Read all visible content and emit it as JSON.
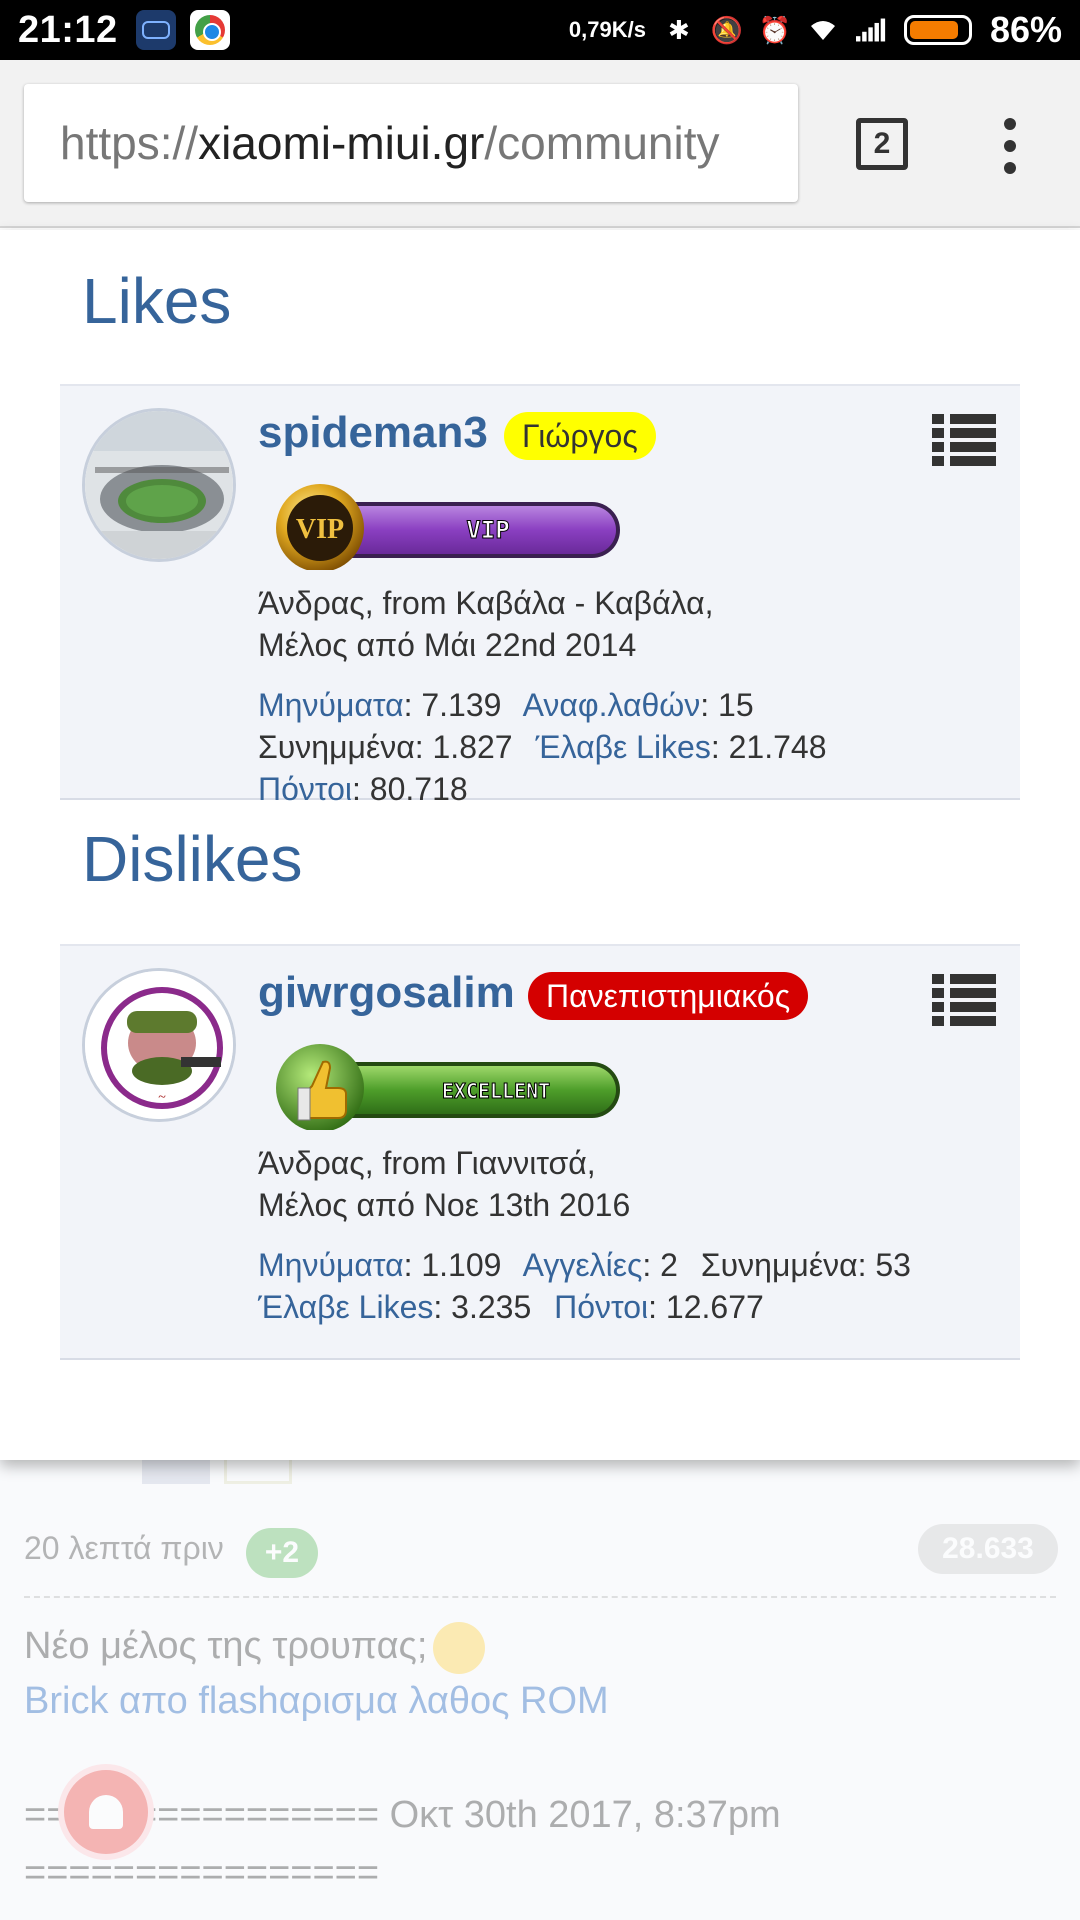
{
  "status_bar": {
    "time": "21:12",
    "net_speed": "0,79K/s",
    "battery_pct": "86%",
    "battery_level": 0.86,
    "icons": [
      "cast-app-icon",
      "chrome-icon",
      "bluetooth-icon",
      "silent-icon",
      "alarm-icon",
      "wifi-icon",
      "signal-icon",
      "battery-icon"
    ]
  },
  "browser": {
    "url_prefix": "https://",
    "url_host": "xiaomi-miui.gr",
    "url_path": "/community",
    "tab_count": "2"
  },
  "popup": {
    "likes_title": "Likes",
    "dislikes_title": "Dislikes",
    "likes_user": {
      "username": "spideman3",
      "tag": "Γιώργος",
      "tag_color": "#ffff00",
      "badge_label": "VIP",
      "badge_sub": "VIP",
      "info_line1": "Άνδρας, from Καβάλα - Καβάλα,",
      "info_line2": "Μέλος από Μάι 22nd 2014",
      "stats": [
        {
          "key": "Μηνύματα",
          "value": "7.139"
        },
        {
          "key": "Αναφ.λαθών",
          "value": "15"
        },
        {
          "key": "Συνημμένα",
          "value": "1.827"
        },
        {
          "key": "Έλαβε Likes",
          "value": "21.748"
        },
        {
          "key": "Πόντοι",
          "value": "80.718"
        }
      ]
    },
    "dislikes_user": {
      "username": "giwrgosalim",
      "tag": "Πανεπιστημιακός",
      "tag_color": "#d40000",
      "badge_label": "EXCELLENT",
      "info_line1": "Άνδρας, from Γιαννιτσά,",
      "info_line2": "Μέλος από Νοε 13th 2016",
      "stats": [
        {
          "key": "Μηνύματα",
          "value": "1.109"
        },
        {
          "key": "Αγγελίες",
          "value": "2"
        },
        {
          "key": "Συνημμένα",
          "value": "53"
        },
        {
          "key": "Έλαβε Likes",
          "value": "3.235"
        },
        {
          "key": "Πόντοι",
          "value": "12.677"
        }
      ]
    }
  },
  "background_post": {
    "time_ago": "20 λεπτά πριν",
    "plus": "+2",
    "score": "28.633",
    "line1": "Νέο μέλος της τρουπας;",
    "line2": "Brick απο flashαρισμα λαθος ROM",
    "line3": "================ Οκτ 30th 2017, 8:37pm",
    "line4": "================"
  },
  "colors": {
    "accent": "#36649a",
    "card_bg": "#f2f4f9"
  }
}
